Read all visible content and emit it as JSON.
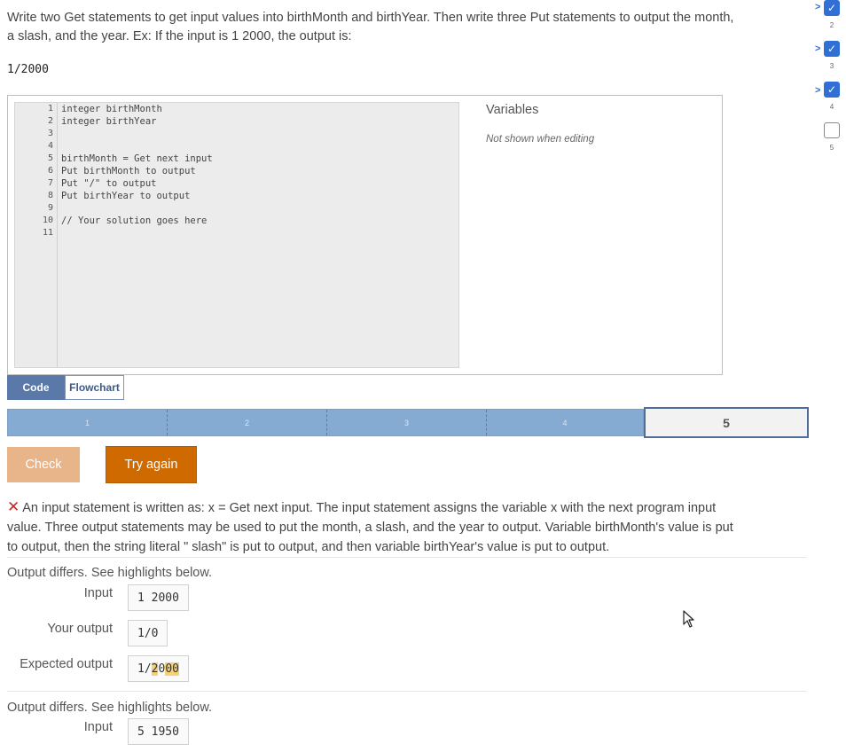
{
  "prompt": {
    "line1": "Write two Get statements to get input values into birthMonth and birthYear. Then write three Put statements to output the month,",
    "line2": "a slash, and the year. Ex: If the input is 1 2000, the output is:",
    "example_output": "1/2000"
  },
  "editor": {
    "line_numbers": [
      "1",
      "2",
      "3",
      "4",
      "5",
      "6",
      "7",
      "8",
      "9",
      "10",
      "11"
    ],
    "lines": [
      "integer birthMonth",
      "integer birthYear",
      "",
      "",
      "birthMonth = Get next input",
      "Put birthMonth to output",
      "Put \"/\" to output",
      "Put birthYear to output",
      "",
      "// Your solution goes here",
      ""
    ]
  },
  "variables": {
    "title": "Variables",
    "note": "Not shown when editing"
  },
  "tabs": {
    "code": "Code",
    "flowchart": "Flowchart"
  },
  "progress": {
    "steps": [
      "1",
      "2",
      "3",
      "4"
    ],
    "current": "5"
  },
  "buttons": {
    "check": "Check",
    "try_again": "Try again"
  },
  "feedback": {
    "x_symbol": "✕",
    "line1": "An input statement is written as: x = Get next input. The input statement assigns the variable x with the next program input",
    "line2": "value. Three output statements may be used to put the month, a slash, and the year to output. Variable birthMonth's value is put",
    "line3": "to output, then the string literal \" slash\" is put to output, and then variable birthYear's value is put to output."
  },
  "test1": {
    "differs": "Output differs. See highlights below.",
    "input_label": "Input",
    "input_value": "1 2000",
    "your_label": "Your output",
    "your_value": "1/0",
    "expected_label": "Expected output",
    "expected_prefix": "1/",
    "expected_hl_a": "2",
    "expected_plain": "0",
    "expected_hl_b": "00"
  },
  "test2": {
    "differs": "Output differs. See highlights below.",
    "input_label": "Input",
    "input_value": "5 1950"
  },
  "side_checklist": {
    "numbers": [
      "2",
      "3",
      "4",
      "5"
    ],
    "checkmark": "✓",
    "bracket": ">"
  },
  "colors": {
    "accent_blue": "#2f6fd6",
    "try_again_orange": "#cf6a00",
    "check_disabled": "#e8b58a",
    "progress_blue": "#86abd3",
    "error_red": "#c62828",
    "highlight": "#fbe7a3"
  },
  "icons": {
    "cursor": "mouse-pointer-icon",
    "error": "x-mark-icon",
    "check": "checkmark-icon"
  }
}
